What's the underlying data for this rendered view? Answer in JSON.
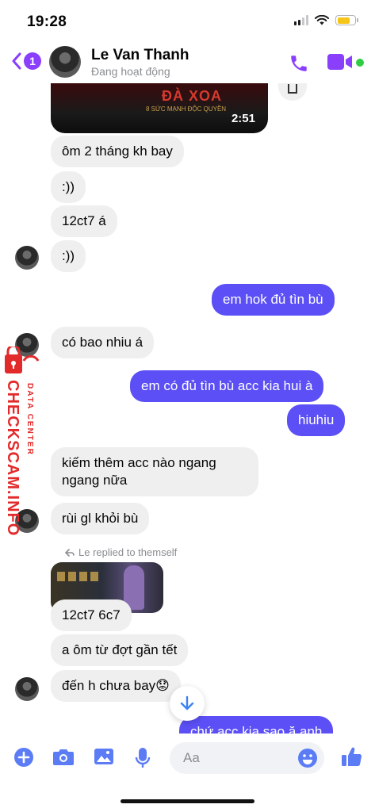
{
  "status_bar": {
    "time": "19:28"
  },
  "header": {
    "back_badge": "1",
    "contact_name": "Le Van Thanh",
    "contact_status": "Đang hoạt động"
  },
  "thread": {
    "video": {
      "title": "ĐÀ XOA",
      "subtitle": "8 SỨC MẠNH ĐỘC QUYỀN",
      "duration": "2:51"
    },
    "messages": [
      {
        "side": "in",
        "text": "ôm 2 tháng kh bay"
      },
      {
        "side": "in",
        "text": ":))"
      },
      {
        "side": "in",
        "text": "12ct7 á"
      },
      {
        "side": "in",
        "text": ":))"
      },
      {
        "side": "out",
        "text": "em hok đủ tìn bù"
      },
      {
        "side": "in",
        "text": "có bao nhiu á"
      },
      {
        "side": "out",
        "text": "em có đủ tìn bù acc kia hui à"
      },
      {
        "side": "out",
        "text": "hiuhiu"
      },
      {
        "side": "in",
        "text": "kiếm thêm acc nào ngang ngang nữa"
      },
      {
        "side": "in",
        "text": "rùi gl khỏi bù"
      },
      {
        "side": "in",
        "text": "12ct7 6c7"
      },
      {
        "side": "in",
        "text": "a ôm từ đợt gần tết"
      },
      {
        "side": "in",
        "text": "đến h chưa bay😟"
      },
      {
        "side": "out",
        "text": "chứ acc kia sao ă anh"
      }
    ],
    "reply_note": "Le replied to themself"
  },
  "watermark": {
    "main": "CHECKSCAM.INFO",
    "sub": "DATA CENTER"
  },
  "composer": {
    "placeholder": "Aa"
  },
  "colors": {
    "accent": "#8a3ffc",
    "outgoing_bubble": "#5b4ff5",
    "incoming_bubble": "#efefef",
    "online": "#31cc46",
    "watermark": "#e32a2a"
  }
}
